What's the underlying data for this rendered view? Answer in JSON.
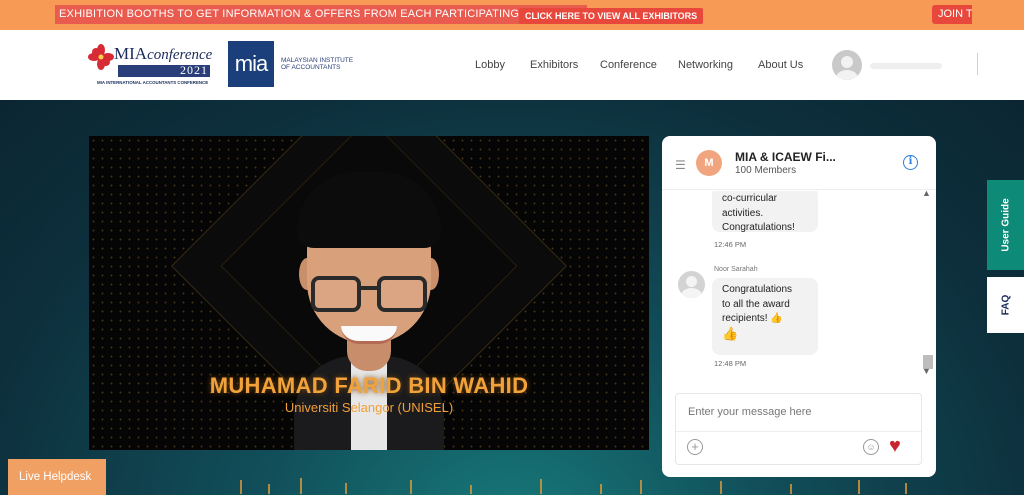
{
  "banner": {
    "ticker": "EXHIBITION BOOTHS TO GET INFORMATION & OFFERS FROM EACH PARTICIPATING EXHIBITOR",
    "cta": "CLICK HERE TO VIEW ALL EXHIBITORS",
    "join": "JOIN T"
  },
  "header": {
    "logo_conf_title_main": "MIA",
    "logo_conf_title_italic": "conference",
    "logo_conf_year": "2021",
    "logo_conf_sub": "MIA INTERNATIONAL ACCOUNTANTS CONFERENCE",
    "logo_mia_text": "mia",
    "logo_mia_name_1": "MALAYSIAN INSTITUTE",
    "logo_mia_name_2": "OF ACCOUNTANTS",
    "nav": [
      "Lobby",
      "Exhibitors",
      "Conference",
      "Networking",
      "About Us"
    ]
  },
  "video": {
    "name": "MUHAMAD FARID BIN WAHID",
    "university": "Universiti Selangor (UNISEL)"
  },
  "chat": {
    "group_initial": "M",
    "title": "MIA & ICAEW Fi...",
    "members": "100 Members",
    "messages": [
      {
        "lines": [
          "co-curricular",
          "activities.",
          "Congratulations!"
        ],
        "time": "12:46 PM"
      },
      {
        "sender": "Noor Sarahah",
        "lines": [
          "Congratulations",
          "to all the award",
          "recipients! 👍",
          "👍"
        ],
        "time": "12:48 PM"
      }
    ],
    "input_placeholder": "Enter your message here"
  },
  "side_tabs": {
    "guide": "User Guide",
    "faq": "FAQ"
  },
  "helpdesk": "Live Helpdesk",
  "colors": {
    "banner": "#f79a55",
    "banner_accent": "#e8483c",
    "accent_gold": "#f2a23b",
    "guide_tab": "#0e8a78",
    "heart": "#c7262e"
  },
  "icons": [
    "flower-logo-icon",
    "hamburger-icon",
    "info-icon",
    "thumbs-up-icon",
    "plus-icon",
    "smile-icon",
    "heart-icon",
    "chevron-up-icon",
    "chevron-down-icon"
  ]
}
